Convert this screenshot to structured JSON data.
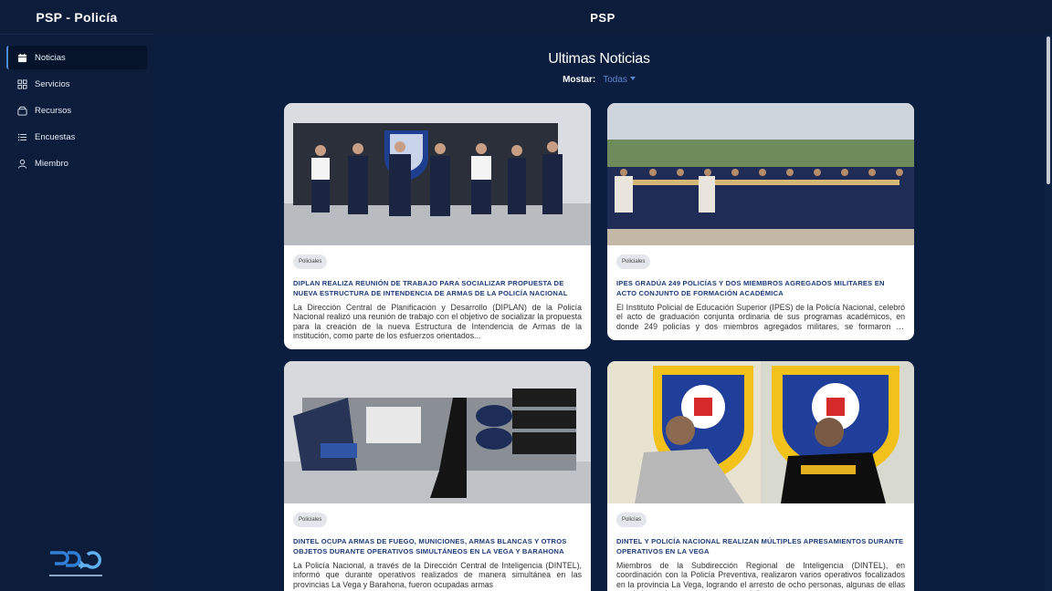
{
  "sidebar": {
    "brand": "PSP - Policía",
    "items": [
      {
        "label": "Noticias",
        "icon": "calendar-icon",
        "active": true
      },
      {
        "label": "Servicios",
        "icon": "grid-icon",
        "active": false
      },
      {
        "label": "Recursos",
        "icon": "box-icon",
        "active": false
      },
      {
        "label": "Encuestas",
        "icon": "list-icon",
        "active": false
      },
      {
        "label": "Miembro",
        "icon": "user-icon",
        "active": false
      }
    ]
  },
  "header": {
    "title": "PSP"
  },
  "main": {
    "heading": "Ultimas Noticias",
    "filter": {
      "label": "Mostar:",
      "value": "Todas"
    }
  },
  "cards": [
    {
      "badge": "Policiales",
      "title": "DIPLAN REALIZA REUNIÓN DE TRABAJO PARA SOCIALIZAR PROPUESTA DE NUEVA ESTRUCTURA DE INTENDENCIA DE ARMAS DE LA POLICÍA NACIONAL",
      "description": "La Dirección Central de Planificación y Desarrollo (DIPLAN) de la Policía Nacional realizó una reunión de trabajo con el objetivo de socializar la propuesta para la creación de la nueva Estructura de Intendencia de Armas de la institución, como parte de los esfuerzos orientados..."
    },
    {
      "badge": "Policiales",
      "title": "IPES GRADÚA 249 POLICÍAS Y DOS MIEMBROS AGREGADOS MILITARES EN ACTO CONJUNTO DE FORMACIÓN ACADÉMICA",
      "description": "El Instituto Policial de Educación Superior (IPES) de la Policía Nacional, celebró el acto de graduación conjunta ordinaria de sus programas académicos, en donde 249 policías y dos miembros agregados militares, se formaron en distintas especialidades, diplomados y program..."
    },
    {
      "badge": "Policiales",
      "title": "DINTEL OCUPA ARMAS DE FUEGO, MUNICIONES, ARMAS BLANCAS Y OTROS OBJETOS DURANTE OPERATIVOS SIMULTÁNEOS EN LA VEGA Y BARAHONA",
      "description": "La Policía Nacional, a través de la Dirección Central de Inteligencia (DINTEL), informó que durante operativos realizados de manera simultánea en las provincias La Vega y Barahona, fueron ocupadas armas"
    },
    {
      "badge": "Policías",
      "title": "DINTEL Y POLICÍA NACIONAL REALIZAN MÚLTIPLES APRESAMIENTOS DURANTE OPERATIVOS EN LA VEGA",
      "description": "Miembros de la Subdirección Regional de Inteligencia (DINTEL), en coordinación con la Policía Preventiva, realizaron varios operativos focalizados en la provincia La Vega, logrando el arresto de ocho personas, algunas de ellas con órdenes de arresto vigentes por delit..."
    }
  ],
  "colors": {
    "background": "#0b1e3f",
    "accent": "#4a8fe7",
    "title": "#1d3b7a",
    "filter": "#5f86d3"
  }
}
